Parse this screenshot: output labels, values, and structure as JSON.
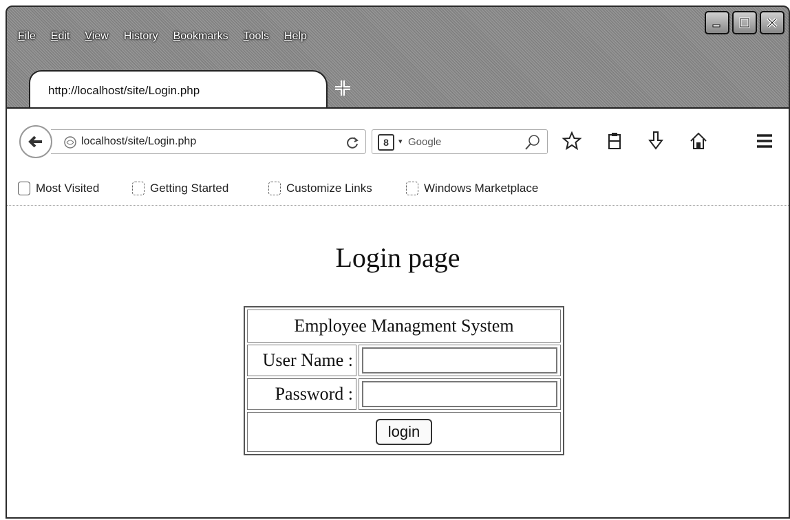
{
  "window": {
    "menu": [
      {
        "label": "File",
        "access_key": "F",
        "rest": "ile"
      },
      {
        "label": "Edit",
        "access_key": "E",
        "rest": "dit"
      },
      {
        "label": "View",
        "access_key": "V",
        "rest": "iew"
      },
      {
        "label": "History",
        "access_key": "",
        "rest": "History"
      },
      {
        "label": "Bookmarks",
        "access_key": "B",
        "rest": "ookmarks"
      },
      {
        "label": "Tools",
        "access_key": "T",
        "rest": "ools"
      },
      {
        "label": "Help",
        "access_key": "H",
        "rest": "elp"
      }
    ]
  },
  "tab": {
    "title": "http://localhost/site/Login.php"
  },
  "navbar": {
    "url": "localhost/site/Login.php",
    "search_placeholder": "Google",
    "search_engine_icon": "8",
    "icons": [
      "back-arrow-icon",
      "reload-icon",
      "search-icon",
      "bookmark-star-icon",
      "clipboard-icon",
      "download-arrow-icon",
      "home-icon",
      "menu-icon"
    ]
  },
  "bookmarks": [
    {
      "label": "Most Visited"
    },
    {
      "label": "Getting Started"
    },
    {
      "label": "Customize Links"
    },
    {
      "label": "Windows Marketplace"
    }
  ],
  "page": {
    "heading": "Login page",
    "form_title": "Employee Managment System",
    "username_label": "User Name :",
    "username_value": "",
    "password_label": "Password :",
    "password_value": "",
    "submit_label": "login"
  },
  "colors": {
    "chrome": "#8a8a8a",
    "page_background": "#ffffff",
    "text": "#111111"
  }
}
